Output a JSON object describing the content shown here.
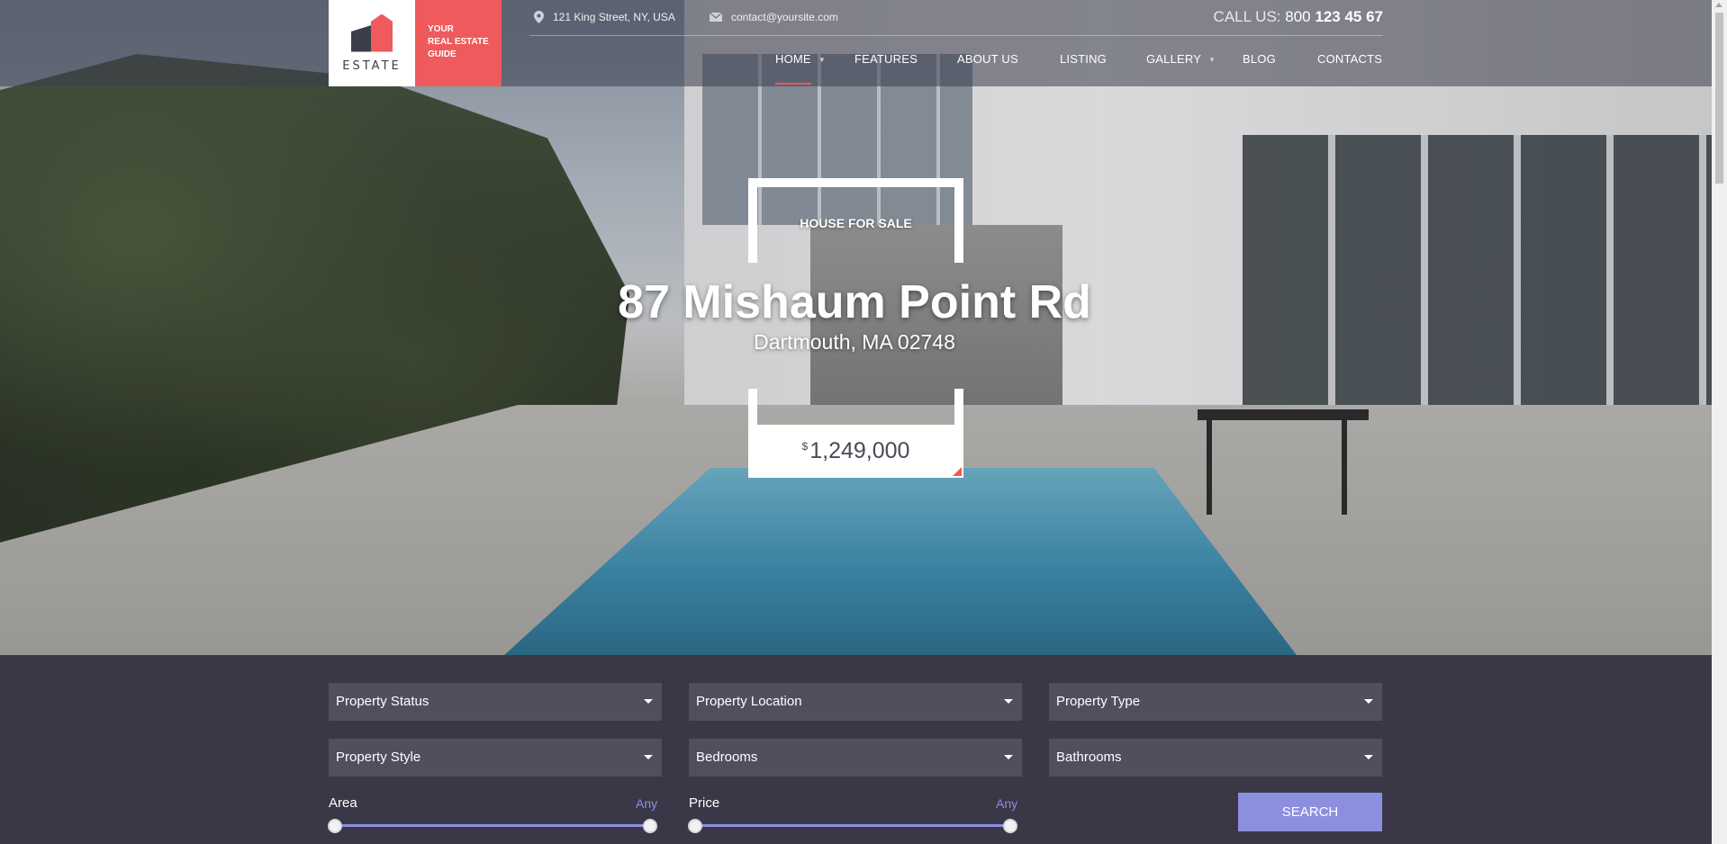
{
  "brand": {
    "name": "ESTATE",
    "tagline": [
      "YOUR",
      "REAL ESTATE",
      "GUIDE"
    ],
    "colors": {
      "accent": "#ef5a5c",
      "dark": "#3b3d4a",
      "panel": "#3a3846",
      "button": "#8c8fe0"
    }
  },
  "contact": {
    "address": "121 King Street, NY, USA",
    "email": "contact@yoursite.com",
    "call_label": "CALL US:",
    "phone_prefix": "800",
    "phone_main": "123 45 67"
  },
  "nav": {
    "items": [
      {
        "label": "HOME",
        "has_caret": true,
        "active": true
      },
      {
        "label": "FEATURES",
        "has_caret": false,
        "active": false
      },
      {
        "label": "ABOUT US",
        "has_caret": false,
        "active": false
      },
      {
        "label": "LISTING",
        "has_caret": false,
        "active": false
      },
      {
        "label": "GALLERY",
        "has_caret": true,
        "active": false
      },
      {
        "label": "BLOG",
        "has_caret": false,
        "active": false
      },
      {
        "label": "CONTACTS",
        "has_caret": false,
        "active": false
      }
    ]
  },
  "hero": {
    "badge": "HOUSE FOR SALE",
    "title": "87 Mishaum Point Rd",
    "subtitle": "Dartmouth, MA 02748",
    "price_currency": "$",
    "price": "1,249,000"
  },
  "search": {
    "selects": [
      "Property Status",
      "Property Location",
      "Property Type",
      "Property Style",
      "Bedrooms",
      "Bathrooms"
    ],
    "area": {
      "label": "Area",
      "value": "Any"
    },
    "price": {
      "label": "Price",
      "value": "Any"
    },
    "button_label": "SEARCH"
  },
  "icons": {
    "address": "map-pin-icon",
    "email": "envelope-icon",
    "dropdown": "caret-down-icon"
  }
}
